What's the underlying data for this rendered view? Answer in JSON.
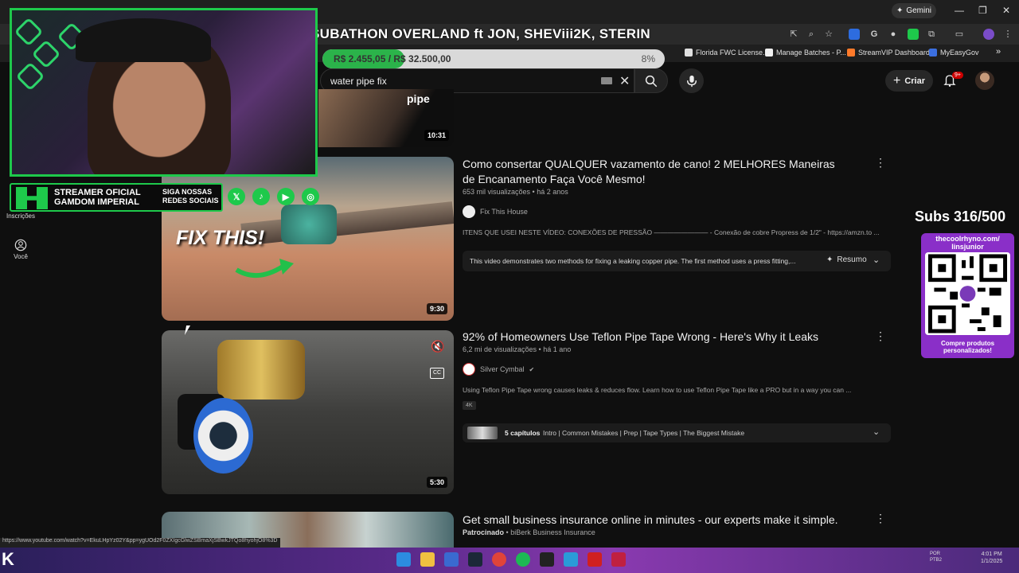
{
  "browser": {
    "gemini_label": "Gemini",
    "window_controls": [
      "—",
      "❐",
      "✕"
    ],
    "bookmarks": [
      {
        "label": "Florida FWC License...",
        "color": "#e0e0e0"
      },
      {
        "label": "Manage Batches - P...",
        "color": "#f0f0f0"
      },
      {
        "label": "StreamVIP Dashboard",
        "color": "#ff7a2a"
      },
      {
        "label": "MyEasyGov",
        "color": "#3b6fe0"
      }
    ],
    "more_label": "»"
  },
  "overlay": {
    "subathon_title": "SUBATHON OVERLAND ft JON, SHEViii2K, STERIN",
    "goal_text": "R$ 2.455,05 / R$ 32.500,00",
    "goal_percent": "8%",
    "goal_fraction": 0.08,
    "streamer_line1": "STREAMER OFICIAL GAMDOM IMPERIAL",
    "streamer_line2": "SIGA NOSSAS REDES SOCIAIS",
    "socials": [
      "𝕏",
      "♪",
      "▶",
      "◎"
    ],
    "subs_count": "Subs 316/500",
    "qr_title": "thecoolrhyno.com/ linsjunior",
    "qr_footer": "Compre produtos personalizados!"
  },
  "youtube": {
    "search_value": "water pipe fix",
    "create_label": "Criar",
    "notif_badge": "9+",
    "nav": {
      "subscriptions": "Inscrições",
      "you": "Você"
    }
  },
  "results": [
    {
      "duration": "10:31"
    },
    {
      "title": "Como consertar QUALQUER vazamento de cano! 2 MELHORES Maneiras de Encanamento Faça Você Mesmo!",
      "meta": "653 mil visualizações • há 2 anos",
      "channel": "Fix This House",
      "description": "ITENS QUE USEI NESTE VÍDEO: CONEXÕES DE PRESSÃO ———————— - Conexão de cobre Propress de 1/2\" - https://amzn.to ...",
      "summary": "This video demonstrates two methods for fixing a leaking copper pipe. The first method uses a press fitting,...",
      "summary_btn": "Resumo",
      "thumb_text": "FIX THIS!",
      "duration": "9:30"
    },
    {
      "title": "92% of Homeowners Use Teflon Pipe Tape Wrong - Here's Why it Leaks",
      "meta": "6,2 mi de visualizações • há 1 ano",
      "channel": "Silver Cymbal",
      "description": "Using Teflon Pipe Tape wrong causes leaks & reduces flow. Learn how to use Teflon Pipe Tape like a PRO but in a way you can ...",
      "badge": "4K",
      "chapters_count": "5 capítulos",
      "chapters": "Intro | Common Mistakes | Prep | Tape Types | The Biggest Mistake",
      "duration": "5:30"
    },
    {
      "title": "Get small business insurance online in minutes - our experts make it simple.",
      "sponsored": "Patrocinado",
      "advertiser": "biBerk Business Insurance"
    }
  ],
  "status_url": "https://www.youtube.com/watch?v=EkuLHpYz02Y&pp=ygUOd2F0ZXIgcGlwZSBmaXjSBwkJTQo8hyohjO8%3D",
  "tray": {
    "time": "4:01 PM",
    "date": "1/1/2025",
    "lang": "POR PTB2"
  }
}
